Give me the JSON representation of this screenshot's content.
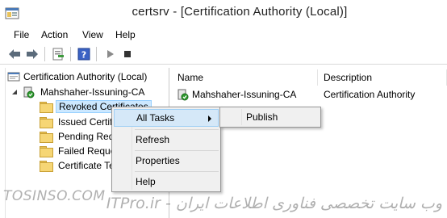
{
  "window": {
    "title": "certsrv - [Certification Authority (Local)]"
  },
  "menubar": {
    "items": [
      "File",
      "Action",
      "View",
      "Help"
    ]
  },
  "toolbar": {
    "buttons": [
      "back-arrow-icon",
      "forward-arrow-icon",
      "export-list-icon",
      "help-icon",
      "play-icon",
      "stop-icon"
    ]
  },
  "tree": {
    "root": "Certification Authority (Local)",
    "ca": "Mahshaher-Issuning-CA",
    "folders": [
      "Revoked Certificates",
      "Issued Certificates",
      "Pending Requests",
      "Failed Requests",
      "Certificate Templates"
    ]
  },
  "list": {
    "columns": [
      "Name",
      "Description"
    ],
    "rows": [
      {
        "name": "Mahshaher-Issuning-CA",
        "description": "Certification Authority"
      }
    ]
  },
  "context_menu": {
    "all_tasks": "All Tasks",
    "refresh": "Refresh",
    "properties": "Properties",
    "help": "Help"
  },
  "submenu": {
    "publish": "Publish"
  },
  "watermark": {
    "left": "TOSINSO.COM",
    "right": "وب سایت تخصصی فناوری اطلاعات ایران - ITPro.ir"
  }
}
